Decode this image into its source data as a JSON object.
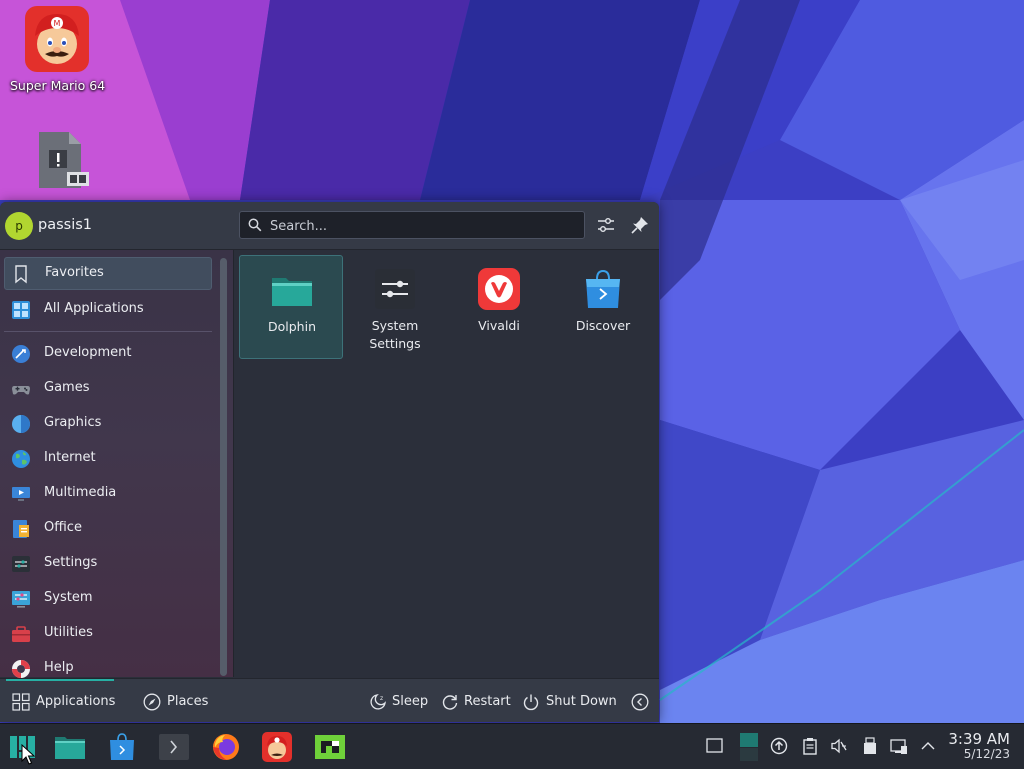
{
  "desktop": {
    "icons": [
      {
        "label": "Super Mario 64",
        "icon": "mario-icon"
      },
      {
        "label": "",
        "icon": "script-file-icon"
      }
    ]
  },
  "launcher": {
    "user": {
      "initial": "p",
      "name": "passis1"
    },
    "search": {
      "placeholder": "Search..."
    },
    "sidebar": {
      "items": [
        {
          "label": "Favorites",
          "icon": "bookmark-icon",
          "active": true
        },
        {
          "label": "All Applications",
          "icon": "grid-icon"
        },
        {
          "label": "Development",
          "icon": "development-icon"
        },
        {
          "label": "Games",
          "icon": "gamepad-icon"
        },
        {
          "label": "Graphics",
          "icon": "graphics-icon"
        },
        {
          "label": "Internet",
          "icon": "globe-icon"
        },
        {
          "label": "Multimedia",
          "icon": "multimedia-icon"
        },
        {
          "label": "Office",
          "icon": "office-icon"
        },
        {
          "label": "Settings",
          "icon": "settings-icon"
        },
        {
          "label": "System",
          "icon": "system-icon"
        },
        {
          "label": "Utilities",
          "icon": "utilities-icon"
        },
        {
          "label": "Help",
          "icon": "lifebuoy-icon"
        }
      ]
    },
    "favorites": [
      {
        "label": "Dolphin",
        "icon": "folder-icon",
        "selected": true
      },
      {
        "label": "System Settings",
        "icon": "system-settings-icon"
      },
      {
        "label": "Vivaldi",
        "icon": "vivaldi-icon"
      },
      {
        "label": "Discover",
        "icon": "discover-icon"
      }
    ],
    "footer": {
      "applications": "Applications",
      "places": "Places",
      "sleep": "Sleep",
      "restart": "Restart",
      "shutdown": "Shut Down"
    }
  },
  "taskbar": {
    "clock_time": "3:39 AM",
    "clock_date": "5/12/23"
  },
  "colors": {
    "accent": "#27b0a4",
    "panel": "#2b2f3a",
    "avatar": "#b1d630"
  }
}
